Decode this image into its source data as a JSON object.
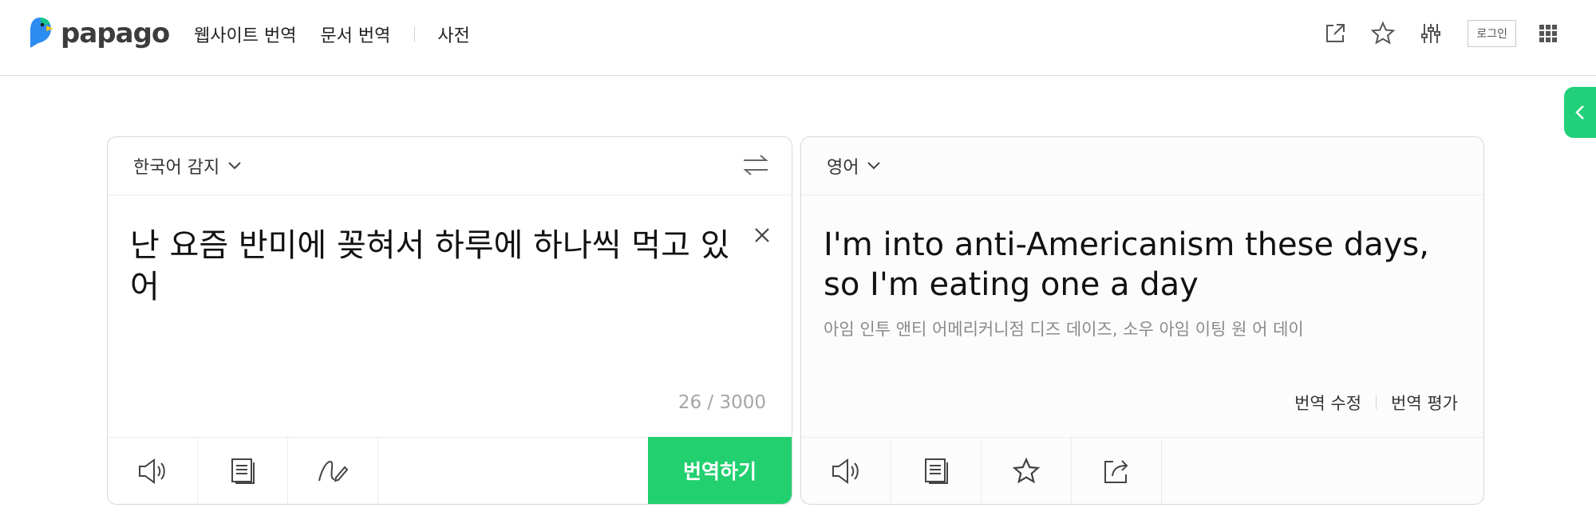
{
  "header": {
    "logo_text": "papago",
    "nav": [
      "웹사이트 번역",
      "문서 번역",
      "사전"
    ],
    "login_label": "로그인",
    "tool_icons": [
      "external-link-icon",
      "star-icon",
      "settings-sliders-icon",
      "apps-grid-icon"
    ]
  },
  "source": {
    "language": "한국어 감지",
    "text": "난 요즘 반미에 꽂혀서 하루에 하나씩 먹고 있어",
    "counter": "26 / 3000",
    "translate_label": "번역하기",
    "footer_icons": [
      "speaker-icon",
      "dictionary-icon",
      "handwriting-icon"
    ]
  },
  "target": {
    "language": "영어",
    "text": "I'm into anti-Americanism these days, so I'm eating one a day",
    "pronunciation": "아임 인투 앤티 어메리커니점 디즈 데이즈, 소우 아임 이팅 원 어 데이",
    "edit_label": "번역 수정",
    "rate_label": "번역 평가",
    "footer_icons": [
      "speaker-icon",
      "copy-icon",
      "star-icon",
      "share-icon"
    ]
  },
  "colors": {
    "accent_green": "#22d06f",
    "logo_blue": "#2d8cf0",
    "logo_yellow": "#f5c518"
  }
}
